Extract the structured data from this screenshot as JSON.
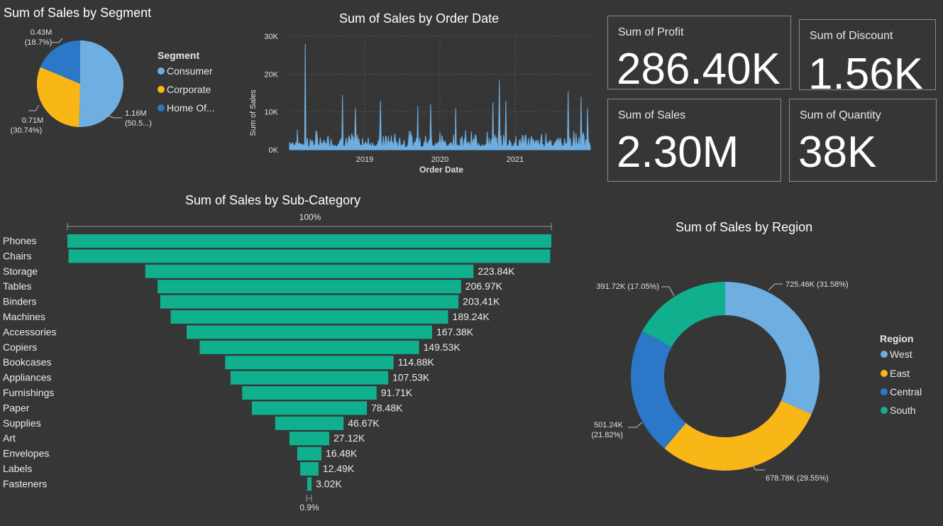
{
  "colors": {
    "background": "#363636",
    "consumer": "#6EAEE0",
    "corporate": "#F9B617",
    "home_office": "#2A78C7",
    "funnel": "#10B08F",
    "line": "#6EAEE0",
    "west": "#6EAEE0",
    "east": "#F9B617",
    "central": "#2A78C7",
    "south": "#10B08F"
  },
  "cards": {
    "profit": {
      "label": "Sum of Profit",
      "value": "286.40K"
    },
    "discount": {
      "label": "Sum of Discount",
      "value": "1.56K"
    },
    "sales": {
      "label": "Sum of Sales",
      "value": "2.30M"
    },
    "quantity": {
      "label": "Sum of Quantity",
      "value": "38K"
    }
  },
  "chart_data": [
    {
      "type": "pie",
      "title": "Sum of Sales by Segment",
      "legend_title": "Segment",
      "legend_position": "right",
      "categories": [
        "Consumer",
        "Corporate",
        "Home Of..."
      ],
      "values": [
        1.16,
        0.71,
        0.43
      ],
      "percents": [
        50.5,
        30.74,
        18.7
      ],
      "data_labels": [
        {
          "value": "1.16M",
          "detail": "(50.5...)"
        },
        {
          "value": "0.71M",
          "detail": "(30.74%)"
        },
        {
          "value": "0.43M",
          "detail": "(18.7%)"
        }
      ]
    },
    {
      "type": "area",
      "title": "Sum of Sales by Order Date",
      "xlabel": "Order Date",
      "ylabel": "Sum of Sales",
      "x_ticks": [
        "2019",
        "2020",
        "2021"
      ],
      "y_ticks": [
        "0K",
        "10K",
        "20K",
        "30K"
      ],
      "ylim": [
        0,
        30000
      ],
      "xlim": [
        "2018-01",
        "2021-12"
      ],
      "spikes": [
        {
          "x": "2018-03",
          "y": 28000
        },
        {
          "x": "2018-09",
          "y": 14500
        },
        {
          "x": "2018-11",
          "y": 11000
        },
        {
          "x": "2019-03",
          "y": 13000
        },
        {
          "x": "2019-09",
          "y": 11500
        },
        {
          "x": "2019-11",
          "y": 12000
        },
        {
          "x": "2020-03",
          "y": 11000
        },
        {
          "x": "2020-09",
          "y": 12500
        },
        {
          "x": "2020-10",
          "y": 18500
        },
        {
          "x": "2020-11",
          "y": 13000
        },
        {
          "x": "2021-09",
          "y": 15500
        },
        {
          "x": "2021-11",
          "y": 14000
        },
        {
          "x": "2021-12",
          "y": 11000
        }
      ]
    },
    {
      "type": "bar",
      "subtype": "funnel",
      "title": "Sum of Sales by Sub-Category",
      "top_label": "100%",
      "bottom_label": "0.9%",
      "categories": [
        "Phones",
        "Chairs",
        "Storage",
        "Tables",
        "Binders",
        "Machines",
        "Accessories",
        "Copiers",
        "Bookcases",
        "Appliances",
        "Furnishings",
        "Paper",
        "Supplies",
        "Art",
        "Envelopes",
        "Labels",
        "Fasteners"
      ],
      "values": [
        330.01,
        328.45,
        223.84,
        206.97,
        203.41,
        189.24,
        167.38,
        149.53,
        114.88,
        107.53,
        91.71,
        78.48,
        46.67,
        27.12,
        16.48,
        12.49,
        3.02
      ],
      "value_labels": [
        "",
        "",
        "223.84K",
        "206.97K",
        "203.41K",
        "189.24K",
        "167.38K",
        "149.53K",
        "114.88K",
        "107.53K",
        "91.71K",
        "78.48K",
        "46.67K",
        "27.12K",
        "16.48K",
        "12.49K",
        "3.02K"
      ]
    },
    {
      "type": "pie",
      "subtype": "donut",
      "title": "Sum of Sales by Region",
      "legend_title": "Region",
      "legend_position": "right",
      "categories": [
        "West",
        "East",
        "Central",
        "South"
      ],
      "values": [
        725.46,
        678.78,
        501.24,
        391.72
      ],
      "data_labels": [
        "725.46K (31.58%)",
        "678.78K (29.55%)",
        "501.24K",
        "(21.82%)",
        "391.72K (17.05%)"
      ]
    }
  ]
}
